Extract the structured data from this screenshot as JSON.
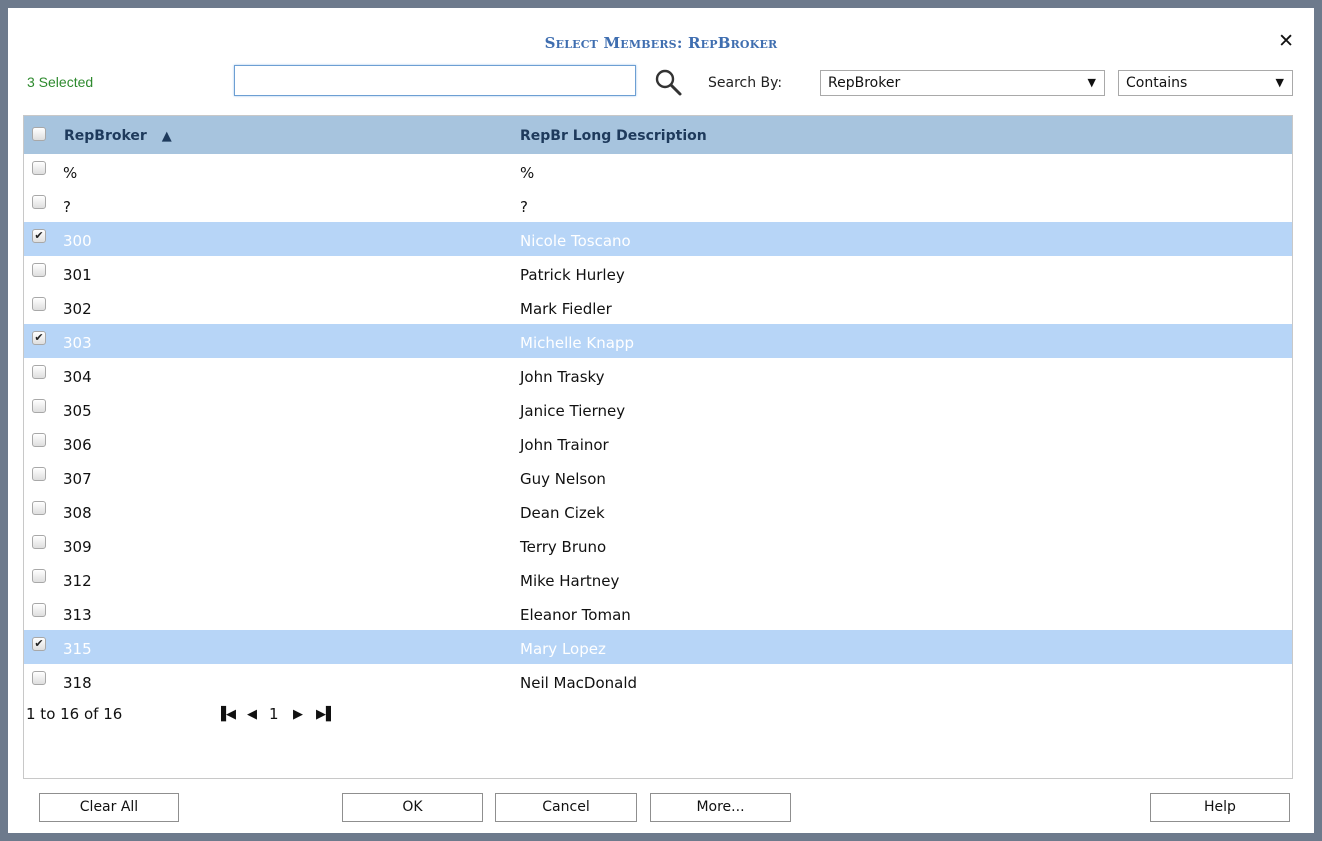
{
  "dialog": {
    "title": "Select Members: RepBroker",
    "close_symbol": "✕",
    "selected_count": "3 Selected"
  },
  "search": {
    "value": "",
    "placeholder": "",
    "search_by_label": "Search By:",
    "search_by_value": "RepBroker",
    "match_value": "Contains"
  },
  "grid": {
    "columns": [
      "RepBroker",
      "RepBr Long Description"
    ],
    "sort_indicator": "▲",
    "rows": [
      {
        "code": "%",
        "desc": "%",
        "checked": false
      },
      {
        "code": "?",
        "desc": "?",
        "checked": false
      },
      {
        "code": "300",
        "desc": "Nicole Toscano",
        "checked": true
      },
      {
        "code": "301",
        "desc": "Patrick Hurley",
        "checked": false
      },
      {
        "code": "302",
        "desc": "Mark Fiedler",
        "checked": false
      },
      {
        "code": "303",
        "desc": "Michelle Knapp",
        "checked": true
      },
      {
        "code": "304",
        "desc": "John Trasky",
        "checked": false
      },
      {
        "code": "305",
        "desc": "Janice Tierney",
        "checked": false
      },
      {
        "code": "306",
        "desc": "John Trainor",
        "checked": false
      },
      {
        "code": "307",
        "desc": "Guy Nelson",
        "checked": false
      },
      {
        "code": "308",
        "desc": "Dean Cizek",
        "checked": false
      },
      {
        "code": "309",
        "desc": "Terry Bruno",
        "checked": false
      },
      {
        "code": "312",
        "desc": "Mike Hartney",
        "checked": false
      },
      {
        "code": "313",
        "desc": "Eleanor Toman",
        "checked": false
      },
      {
        "code": "315",
        "desc": "Mary Lopez",
        "checked": true
      },
      {
        "code": "318",
        "desc": "Neil MacDonald",
        "checked": false
      }
    ]
  },
  "pager": {
    "range": "1 to 16 of 16",
    "page": "1"
  },
  "buttons": {
    "clear_all": "Clear All",
    "ok": "OK",
    "cancel": "Cancel",
    "more": "More...",
    "help": "Help"
  },
  "colors": {
    "header_bg": "#a7c4de",
    "selected_row_bg": "#b7d5f7",
    "title_color": "#3f6eb0",
    "count_color": "#2e8a2e"
  }
}
